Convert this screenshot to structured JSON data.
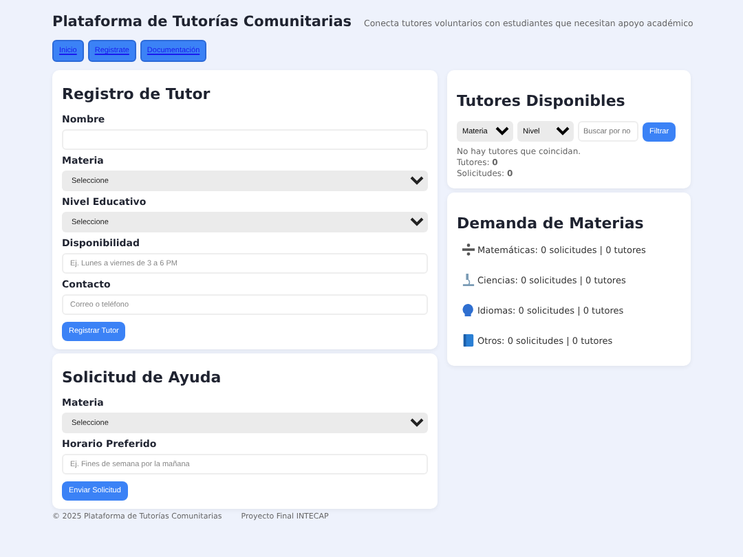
{
  "header": {
    "title": "Plataforma de Tutorías Comunitarias",
    "subtitle": "Conecta tutores voluntarios con estudiantes que necesitan apoyo académico"
  },
  "nav": [
    "Inicio",
    "Registrate",
    "Documentación"
  ],
  "tutor_form": {
    "title": "Registro de Tutor",
    "fields": [
      {
        "kind": "input",
        "label": "Nombre"
      },
      {
        "kind": "select",
        "label": "Materia",
        "value": "Seleccione"
      },
      {
        "kind": "select",
        "label": "Nivel Educativo",
        "value": "Seleccione"
      },
      {
        "kind": "input",
        "label": "Disponibilidad",
        "placeholder": "Ej. Lunes a viernes de 3 a 6 PM"
      },
      {
        "kind": "input",
        "label": "Contacto",
        "placeholder": "Correo o teléfono"
      }
    ],
    "button": "Registrar Tutor"
  },
  "help_form": {
    "title": "Solicitud de Ayuda",
    "fields": [
      {
        "kind": "select",
        "label": "Materia",
        "value": "Seleccione"
      },
      {
        "kind": "input",
        "label": "Horario Preferido",
        "placeholder": "Ej. Fines de semana por la mañana"
      }
    ],
    "button": "Enviar Solicitud"
  },
  "tutors": {
    "title": "Tutores Disponibles",
    "filters": {
      "subject": "Materia",
      "level": "Nivel",
      "search_placeholder": "Buscar por no",
      "button": "Filtrar"
    },
    "empty_message": "No hay tutores que coincidan.",
    "stats": [
      {
        "label": "Tutores:",
        "value": "0"
      },
      {
        "label": "Solicitudes:",
        "value": "0"
      }
    ]
  },
  "demand": {
    "title": "Demanda de Materias",
    "items": [
      {
        "kind": "divide",
        "text": "Matemáticas: 0 solicitudes | 0 tutores"
      },
      {
        "kind": "microscope",
        "text": "Ciencias: 0 solicitudes | 0 tutores"
      },
      {
        "kind": "speaking-head",
        "text": "Idiomas: 0 solicitudes | 0 tutores"
      },
      {
        "kind": "book",
        "text": "Otros: 0 solicitudes | 0 tutores"
      }
    ]
  },
  "footer": {
    "copyright": "© 2025 Plataforma de Tutorías Comunitarias",
    "project": "Proyecto Final INTECAP"
  }
}
